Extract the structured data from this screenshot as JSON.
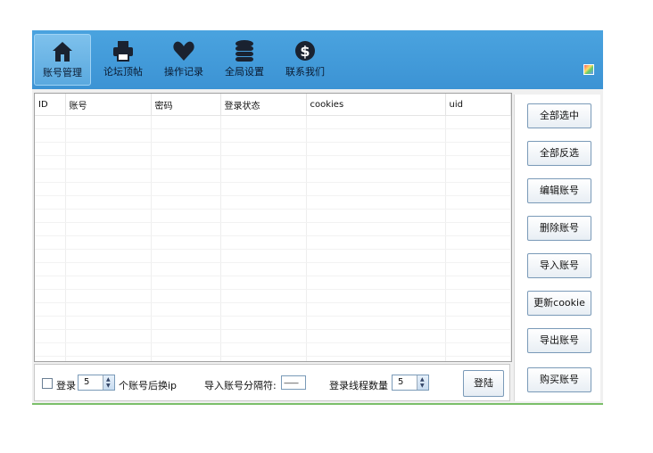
{
  "toolbar": {
    "items": [
      {
        "label": "账号管理",
        "icon": "home-icon"
      },
      {
        "label": "论坛顶帖",
        "icon": "printer-icon"
      },
      {
        "label": "操作记录",
        "icon": "heart-icon"
      },
      {
        "label": "全局设置",
        "icon": "database-icon"
      },
      {
        "label": "联系我们",
        "icon": "dollar-icon"
      }
    ]
  },
  "table": {
    "columns": [
      "ID",
      "账号",
      "密码",
      "登录状态",
      "cookies",
      "uid"
    ]
  },
  "sidebar": {
    "buttons": [
      "全部选中",
      "全部反选",
      "编辑账号",
      "删除账号",
      "导入账号",
      "更新cookie",
      "导出账号",
      "购买账号"
    ]
  },
  "bottom": {
    "login_label": "登录",
    "switch_count": "5",
    "switch_suffix": "个账号后换ip",
    "separator_label": "导入账号分隔符:",
    "separator_value": "——",
    "threads_label": "登录线程数量",
    "threads_value": "5",
    "login_button": "登陆"
  },
  "colors": {
    "toolbar": "#3c93d4",
    "accent_line": "#7bbf6a"
  }
}
